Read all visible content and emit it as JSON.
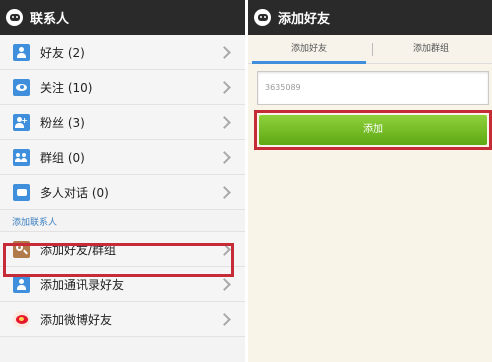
{
  "left_panel": {
    "title": "联系人",
    "items": [
      {
        "label": "好友 (2)",
        "icon": "friend-icon"
      },
      {
        "label": "关注 (10)",
        "icon": "eye-icon"
      },
      {
        "label": "粉丝 (3)",
        "icon": "fans-icon"
      },
      {
        "label": "群组 (0)",
        "icon": "group-icon"
      },
      {
        "label": "多人对话 (0)",
        "icon": "chat-icon"
      }
    ],
    "section_header": "添加联系人",
    "add_items": [
      {
        "label": "添加好友/群组",
        "icon": "search-icon"
      },
      {
        "label": "添加通讯录好友",
        "icon": "contacts-icon"
      },
      {
        "label": "添加微博好友",
        "icon": "weibo-icon"
      }
    ]
  },
  "right_panel": {
    "title": "添加好友",
    "tabs": [
      {
        "label": "添加好友",
        "active": true
      },
      {
        "label": "添加群组",
        "active": false
      }
    ],
    "input_value": "3635089",
    "add_button_label": "添加"
  },
  "colors": {
    "titlebar": "#2a2a2a",
    "accent_blue": "#3f8fdc",
    "highlight_red": "#c62b38",
    "button_green": "#6fbf1f"
  }
}
